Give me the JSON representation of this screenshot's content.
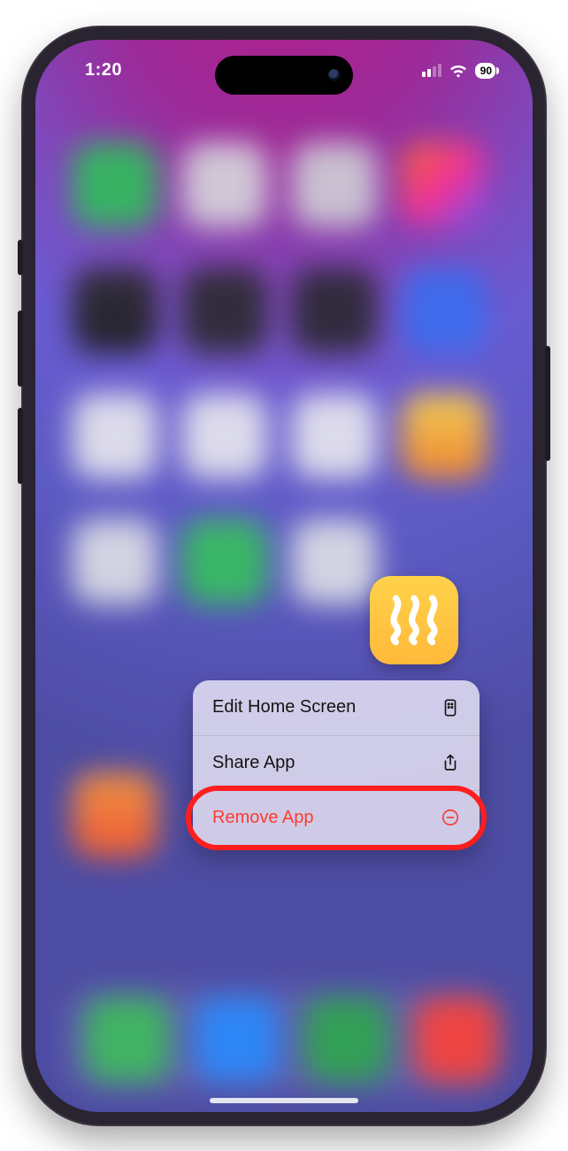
{
  "status": {
    "time": "1:20",
    "battery_pct": "90"
  },
  "app": {
    "icon_name": "vibration-app-icon"
  },
  "menu": {
    "items": [
      {
        "label": "Edit Home Screen",
        "icon": "home-screen-icon",
        "danger": false
      },
      {
        "label": "Share App",
        "icon": "share-icon",
        "danger": false
      },
      {
        "label": "Remove App",
        "icon": "remove-icon",
        "danger": true
      }
    ]
  },
  "annotation": {
    "highlighted_item_index": 2
  }
}
